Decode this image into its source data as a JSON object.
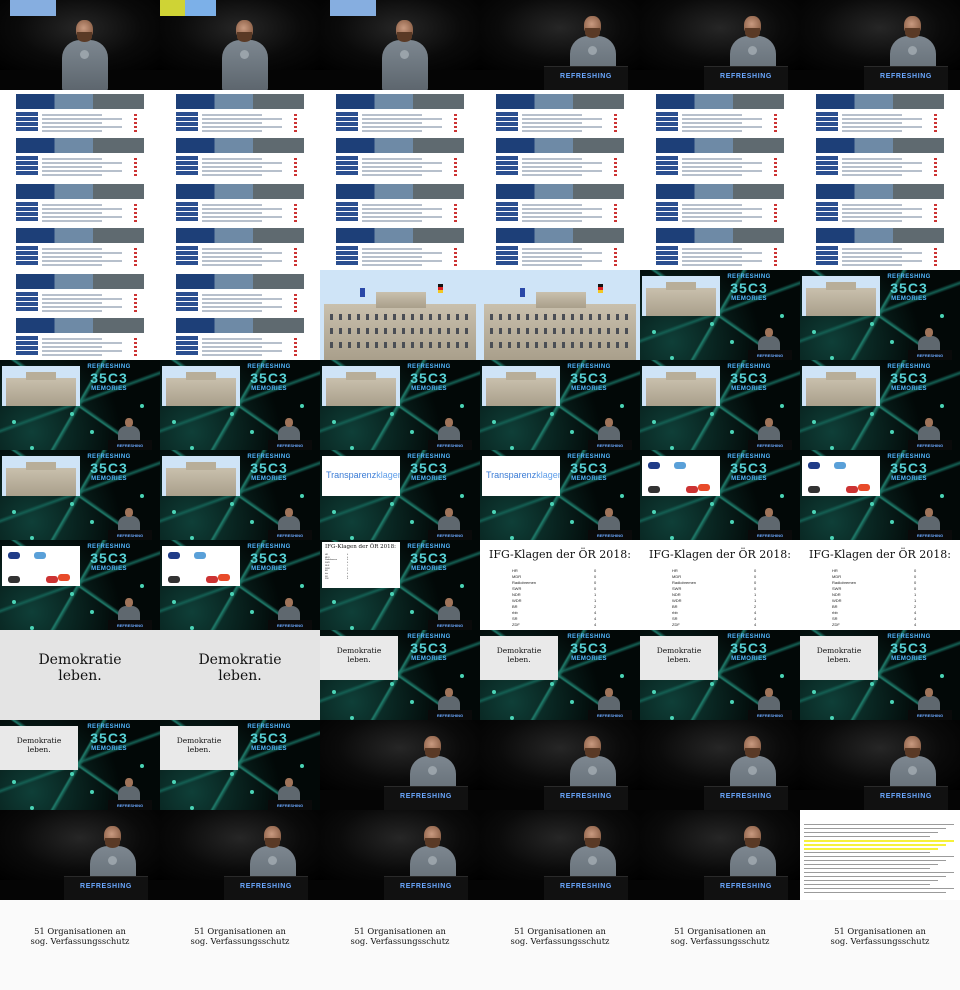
{
  "grid": {
    "columns": 6,
    "rows": 11,
    "frame_count": 66
  },
  "stage": {
    "lectern_text": "REFRESHING"
  },
  "event_logo": {
    "top": "REFRESHING",
    "mark": "35C3",
    "bottom": "MEMORIES"
  },
  "slides": {
    "transparenzklagen": {
      "title_part1": "Transparenz",
      "title_part2": "klagen"
    },
    "ifg": {
      "title": "IFG-Klagen der ÖR 2018:",
      "rows": [
        {
          "name": "HR",
          "value": "0"
        },
        {
          "name": "MDR",
          "value": "0"
        },
        {
          "name": "Radiobremen",
          "value": "0"
        },
        {
          "name": "SWR",
          "value": "0"
        },
        {
          "name": "NDR",
          "value": "1"
        },
        {
          "name": "WDR",
          "value": "1"
        },
        {
          "name": "BR",
          "value": "2"
        },
        {
          "name": "rbb",
          "value": "4"
        },
        {
          "name": "SR",
          "value": "4"
        },
        {
          "name": "ZDF",
          "value": "4"
        }
      ]
    },
    "demokratie": {
      "line1": "Demokratie",
      "line2": "leben."
    },
    "organisationen": {
      "line1": "51 Organisationen an",
      "line2": "sog. Verfassungsschutz"
    }
  },
  "frames": [
    "speaker-screen",
    "speaker-screen-yellow",
    "speaker-screen",
    "speaker-wide",
    "speaker-wide",
    "speaker-wide",
    "website",
    "website",
    "website",
    "website",
    "website",
    "website",
    "website",
    "website",
    "website",
    "website",
    "website",
    "website",
    "website",
    "website",
    "building",
    "building",
    "network-building",
    "network-building",
    "network-building",
    "network-building",
    "network-building",
    "network-building",
    "network-building",
    "network-building",
    "network-building",
    "network-building",
    "network-transparenz",
    "network-transparenz",
    "network-logos",
    "network-logos",
    "network-logos",
    "network-logos",
    "network-ifg",
    "ifg",
    "ifg",
    "ifg",
    "demokratie-full",
    "demokratie-full",
    "network-demokratie",
    "network-demokratie",
    "network-demokratie",
    "network-demokratie",
    "network-demokratie",
    "network-demokratie",
    "speaker-wide",
    "speaker-wide",
    "speaker-wide",
    "speaker-wide",
    "speaker-wide",
    "speaker-wide",
    "speaker-wide",
    "speaker-wide",
    "speaker-wide",
    "document",
    "organisationen",
    "organisationen",
    "organisationen",
    "organisationen",
    "organisationen",
    "organisationen"
  ]
}
